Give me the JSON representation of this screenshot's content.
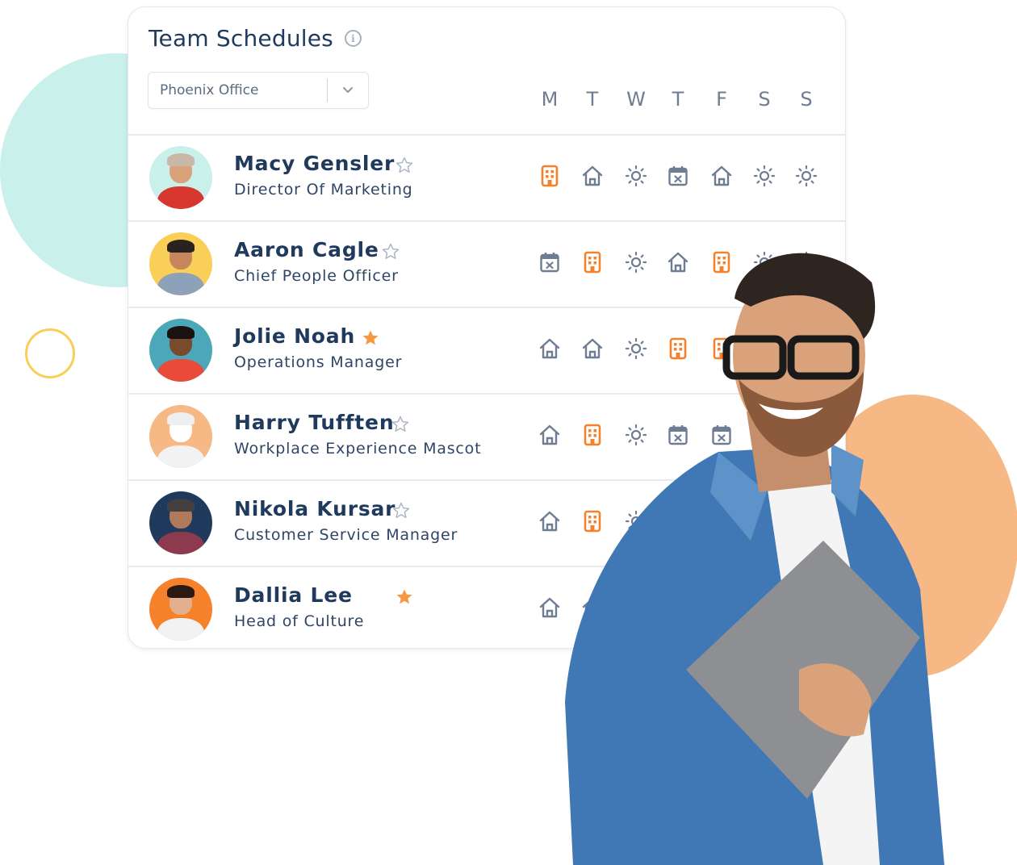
{
  "header": {
    "title": "Team Schedules",
    "info_icon": "info-icon",
    "office_select": {
      "value": "Phoenix Office",
      "icon": "chevron-down-icon"
    }
  },
  "days": [
    "M",
    "T",
    "W",
    "T",
    "F",
    "S",
    "S"
  ],
  "legend_icons": {
    "office": "building-icon",
    "home": "home-icon",
    "off": "sun-icon",
    "leave": "calendar-x-icon"
  },
  "colors": {
    "accent_orange": "#f5822a",
    "icon_gray": "#6f7d92",
    "title_navy": "#1f3a5c",
    "star_filled": "#f59a42",
    "teal_blob": "#c9f0ea",
    "orange_blob": "#f6b986",
    "yellow_ring": "#f9cf57"
  },
  "members": [
    {
      "name": "Macy Gensler",
      "role": "Director Of Marketing",
      "favorite": false,
      "avatar_bg": "#c9f0ea",
      "schedule": [
        "office",
        "home",
        "off",
        "leave",
        "home",
        "off",
        "off"
      ]
    },
    {
      "name": "Aaron Cagle",
      "role": "Chief People Officer",
      "favorite": false,
      "avatar_bg": "#f9cf57",
      "schedule": [
        "leave",
        "office",
        "off",
        "home",
        "office",
        "off",
        "off"
      ]
    },
    {
      "name": "Jolie Noah",
      "role": "Operations Manager",
      "favorite": true,
      "avatar_bg": "#4aa8b8",
      "schedule": [
        "home",
        "home",
        "off",
        "office",
        "office"
      ]
    },
    {
      "name": "Harry Tufften",
      "role": "Workplace Experience Mascot",
      "favorite": false,
      "avatar_bg": "#f6b986",
      "schedule": [
        "home",
        "office",
        "off",
        "leave",
        "leave"
      ]
    },
    {
      "name": "Nikola Kursar",
      "role": "Customer Service Manager",
      "favorite": false,
      "avatar_bg": "#1f3a5c",
      "schedule": [
        "home",
        "office",
        "off"
      ]
    },
    {
      "name": "Dallia Lee",
      "role": "Head of Culture",
      "favorite": true,
      "avatar_bg": "#f5822a",
      "schedule": [
        "home",
        "home"
      ]
    }
  ]
}
